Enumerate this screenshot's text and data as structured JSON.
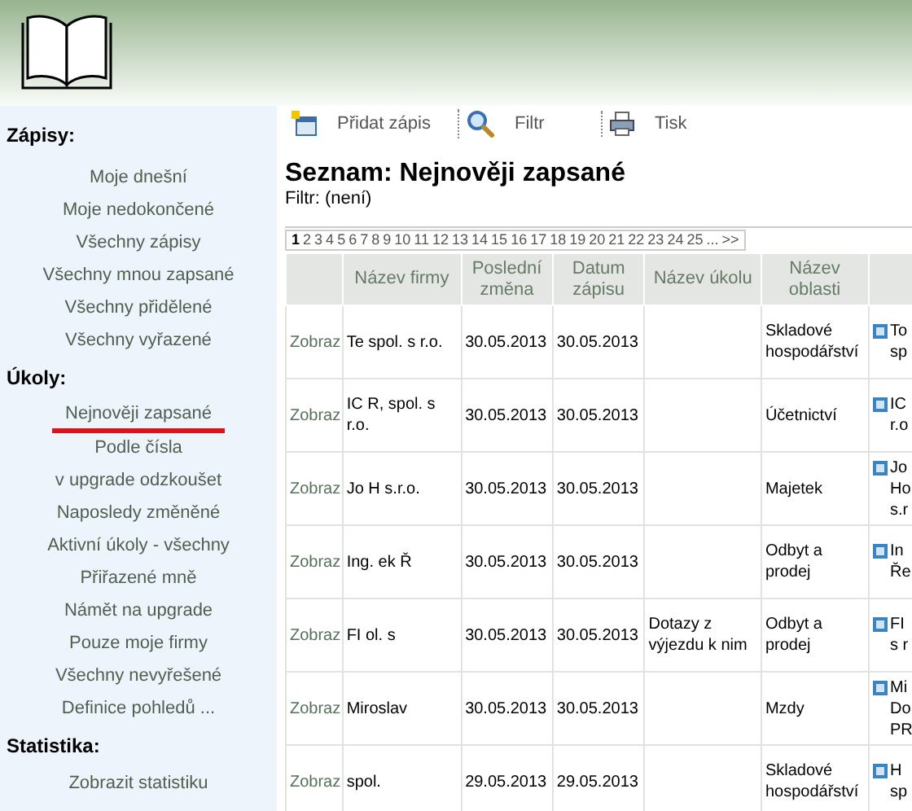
{
  "sidebar": {
    "sections": [
      {
        "title": "Zápisy:",
        "items": [
          {
            "label": "Moje dnešní",
            "selected": false
          },
          {
            "label": "Moje nedokončené",
            "selected": false
          },
          {
            "label": "Všechny zápisy",
            "selected": false
          },
          {
            "label": "Všechny mnou zapsané",
            "selected": false
          },
          {
            "label": "Všechny přidělené",
            "selected": false
          },
          {
            "label": "Všechny vyřazené",
            "selected": false
          }
        ]
      },
      {
        "title": "Úkoly:",
        "items": [
          {
            "label": "Nejnověji zapsané",
            "selected": true
          },
          {
            "label": "Podle čísla",
            "selected": false
          },
          {
            "label": "v upgrade odzkoušet",
            "selected": false
          },
          {
            "label": "Naposledy změněné",
            "selected": false
          },
          {
            "label": "Aktivní úkoly - všechny",
            "selected": false
          },
          {
            "label": "Přiřazené mně",
            "selected": false
          },
          {
            "label": "Námět na upgrade",
            "selected": false
          },
          {
            "label": "Pouze moje firmy",
            "selected": false
          },
          {
            "label": "Všechny nevyřešené",
            "selected": false
          },
          {
            "label": "Definice pohledů ...",
            "selected": false
          }
        ]
      },
      {
        "title": "Statistika:",
        "items": [
          {
            "label": "Zobrazit statistiku",
            "selected": false
          }
        ]
      }
    ]
  },
  "toolbar": [
    {
      "kind": "add",
      "label": "Přidat zápis"
    },
    {
      "kind": "search",
      "label": "Filtr"
    },
    {
      "kind": "print",
      "label": "Tisk"
    }
  ],
  "title": "Seznam: Nejnověji zapsané",
  "filter": "Filtr: (není)",
  "pager": [
    {
      "label": "1",
      "selected": true
    },
    {
      "label": "2",
      "selected": false
    },
    {
      "label": "3",
      "selected": false
    },
    {
      "label": "4",
      "selected": false
    },
    {
      "label": "5",
      "selected": false
    },
    {
      "label": "6",
      "selected": false
    },
    {
      "label": "7",
      "selected": false
    },
    {
      "label": "8",
      "selected": false
    },
    {
      "label": "9",
      "selected": false
    },
    {
      "label": "10",
      "selected": false
    },
    {
      "label": "11",
      "selected": false
    },
    {
      "label": "12",
      "selected": false
    },
    {
      "label": "13",
      "selected": false
    },
    {
      "label": "14",
      "selected": false
    },
    {
      "label": "15",
      "selected": false
    },
    {
      "label": "16",
      "selected": false
    },
    {
      "label": "17",
      "selected": false
    },
    {
      "label": "18",
      "selected": false
    },
    {
      "label": "19",
      "selected": false
    },
    {
      "label": "20",
      "selected": false
    },
    {
      "label": "21",
      "selected": false
    },
    {
      "label": "22",
      "selected": false
    },
    {
      "label": "23",
      "selected": false
    },
    {
      "label": "24",
      "selected": false
    },
    {
      "label": "25",
      "selected": false
    },
    {
      "label": "...",
      "selected": false
    },
    {
      "label": ">>",
      "selected": false
    }
  ],
  "table": {
    "columns": [
      "",
      "Název firmy",
      "Poslední změna",
      "Datum zápisu",
      "Název úkolu",
      "Název oblasti",
      ""
    ],
    "rows": [
      {
        "link": "Zobraz",
        "firm": "Te spol. s r.o.",
        "changed": "30.05.2013",
        "created": "30.05.2013",
        "task": "",
        "area": "Skladové hospodářství",
        "column_7": "To sp"
      },
      {
        "link": "Zobraz",
        "firm": "IC R, spol. s r.o.",
        "changed": "30.05.2013",
        "created": "30.05.2013",
        "task": "",
        "area": "Účetnictví",
        "column_7": "IC r.o"
      },
      {
        "link": "Zobraz",
        "firm": "Jo H s.r.o.",
        "changed": "30.05.2013",
        "created": "30.05.2013",
        "task": "",
        "area": "Majetek",
        "column_7": "Jo Ho s.r"
      },
      {
        "link": "Zobraz",
        "firm": "Ing. ek Ř",
        "changed": "30.05.2013",
        "created": "30.05.2013",
        "task": "",
        "area": "Odbyt a prodej",
        "column_7": "In Ře"
      },
      {
        "link": "Zobraz",
        "firm": "FI ol. s",
        "changed": "30.05.2013",
        "created": "30.05.2013",
        "task": "Dotazy z výjezdu k nim",
        "area": "Odbyt a prodej",
        "column_7": "FI s r"
      },
      {
        "link": "Zobraz",
        "firm": "Miroslav",
        "changed": "30.05.2013",
        "created": "30.05.2013",
        "task": "",
        "area": "Mzdy",
        "column_7": "Mi Do PR"
      },
      {
        "link": "Zobraz",
        "firm": "spol.",
        "changed": "29.05.2013",
        "created": "29.05.2013",
        "task": "",
        "area": "Skladové hospodářství",
        "column_7": "H sp"
      }
    ]
  }
}
